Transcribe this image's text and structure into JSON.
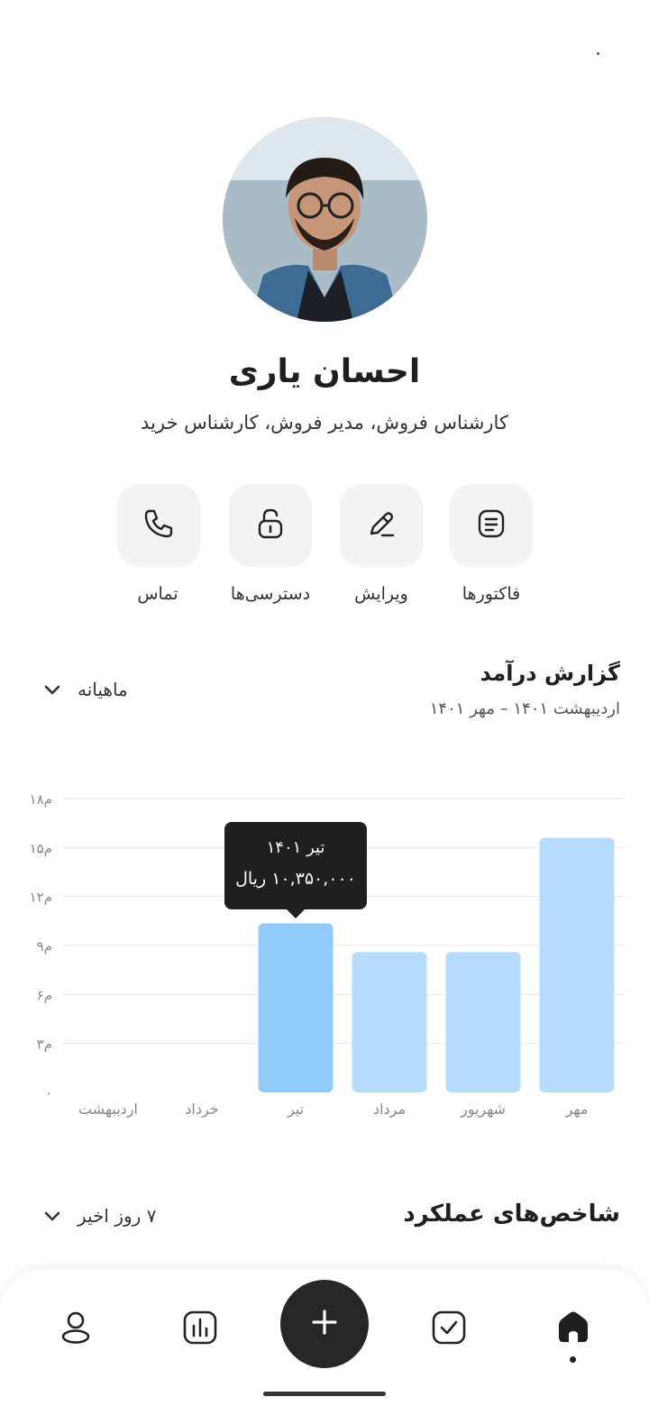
{
  "profile": {
    "name": "احسان یاری",
    "roles": "کارشناس فروش، مدیر فروش، کارشناس خرید"
  },
  "actions": [
    {
      "label": "فاکتورها",
      "icon": "invoice-icon"
    },
    {
      "label": "ویرایش",
      "icon": "edit-icon"
    },
    {
      "label": "دسترسی‌ها",
      "icon": "unlock-icon"
    },
    {
      "label": "تماس",
      "icon": "phone-icon"
    }
  ],
  "revenue": {
    "title": "گزارش درآمد",
    "range": "اردیبهشت ۱۴۰۱ – مهر ۱۴۰۱",
    "period": "ماهیانه"
  },
  "tooltip": {
    "month": "تیر ۱۴۰۱",
    "amount": "۱۰,۳۵۰,۰۰۰ ریال"
  },
  "chart_data": {
    "type": "bar",
    "categories": [
      "اردیبهشت",
      "خرداد",
      "تیر",
      "مرداد",
      "شهریور",
      "مهر"
    ],
    "values": [
      0,
      0,
      10.35,
      8.6,
      8.6,
      15.6
    ],
    "ytick_labels": [
      "۰",
      "۳م",
      "۶م",
      "۹م",
      "۱۲م",
      "۱۵م",
      "۱۸م"
    ],
    "ylim": [
      0,
      18
    ],
    "highlight_index": 2,
    "colors": {
      "bar": "#b7dcfb",
      "highlight": "#90cbfb",
      "grid": "#e6e6e6"
    }
  },
  "kpi": {
    "title": "شاخص‌های عملکرد",
    "period": "۷ روز اخیر"
  },
  "nav": {
    "items": [
      "profile-icon",
      "chart-icon",
      "add-icon",
      "task-icon",
      "home-icon"
    ],
    "active": "home-icon"
  }
}
